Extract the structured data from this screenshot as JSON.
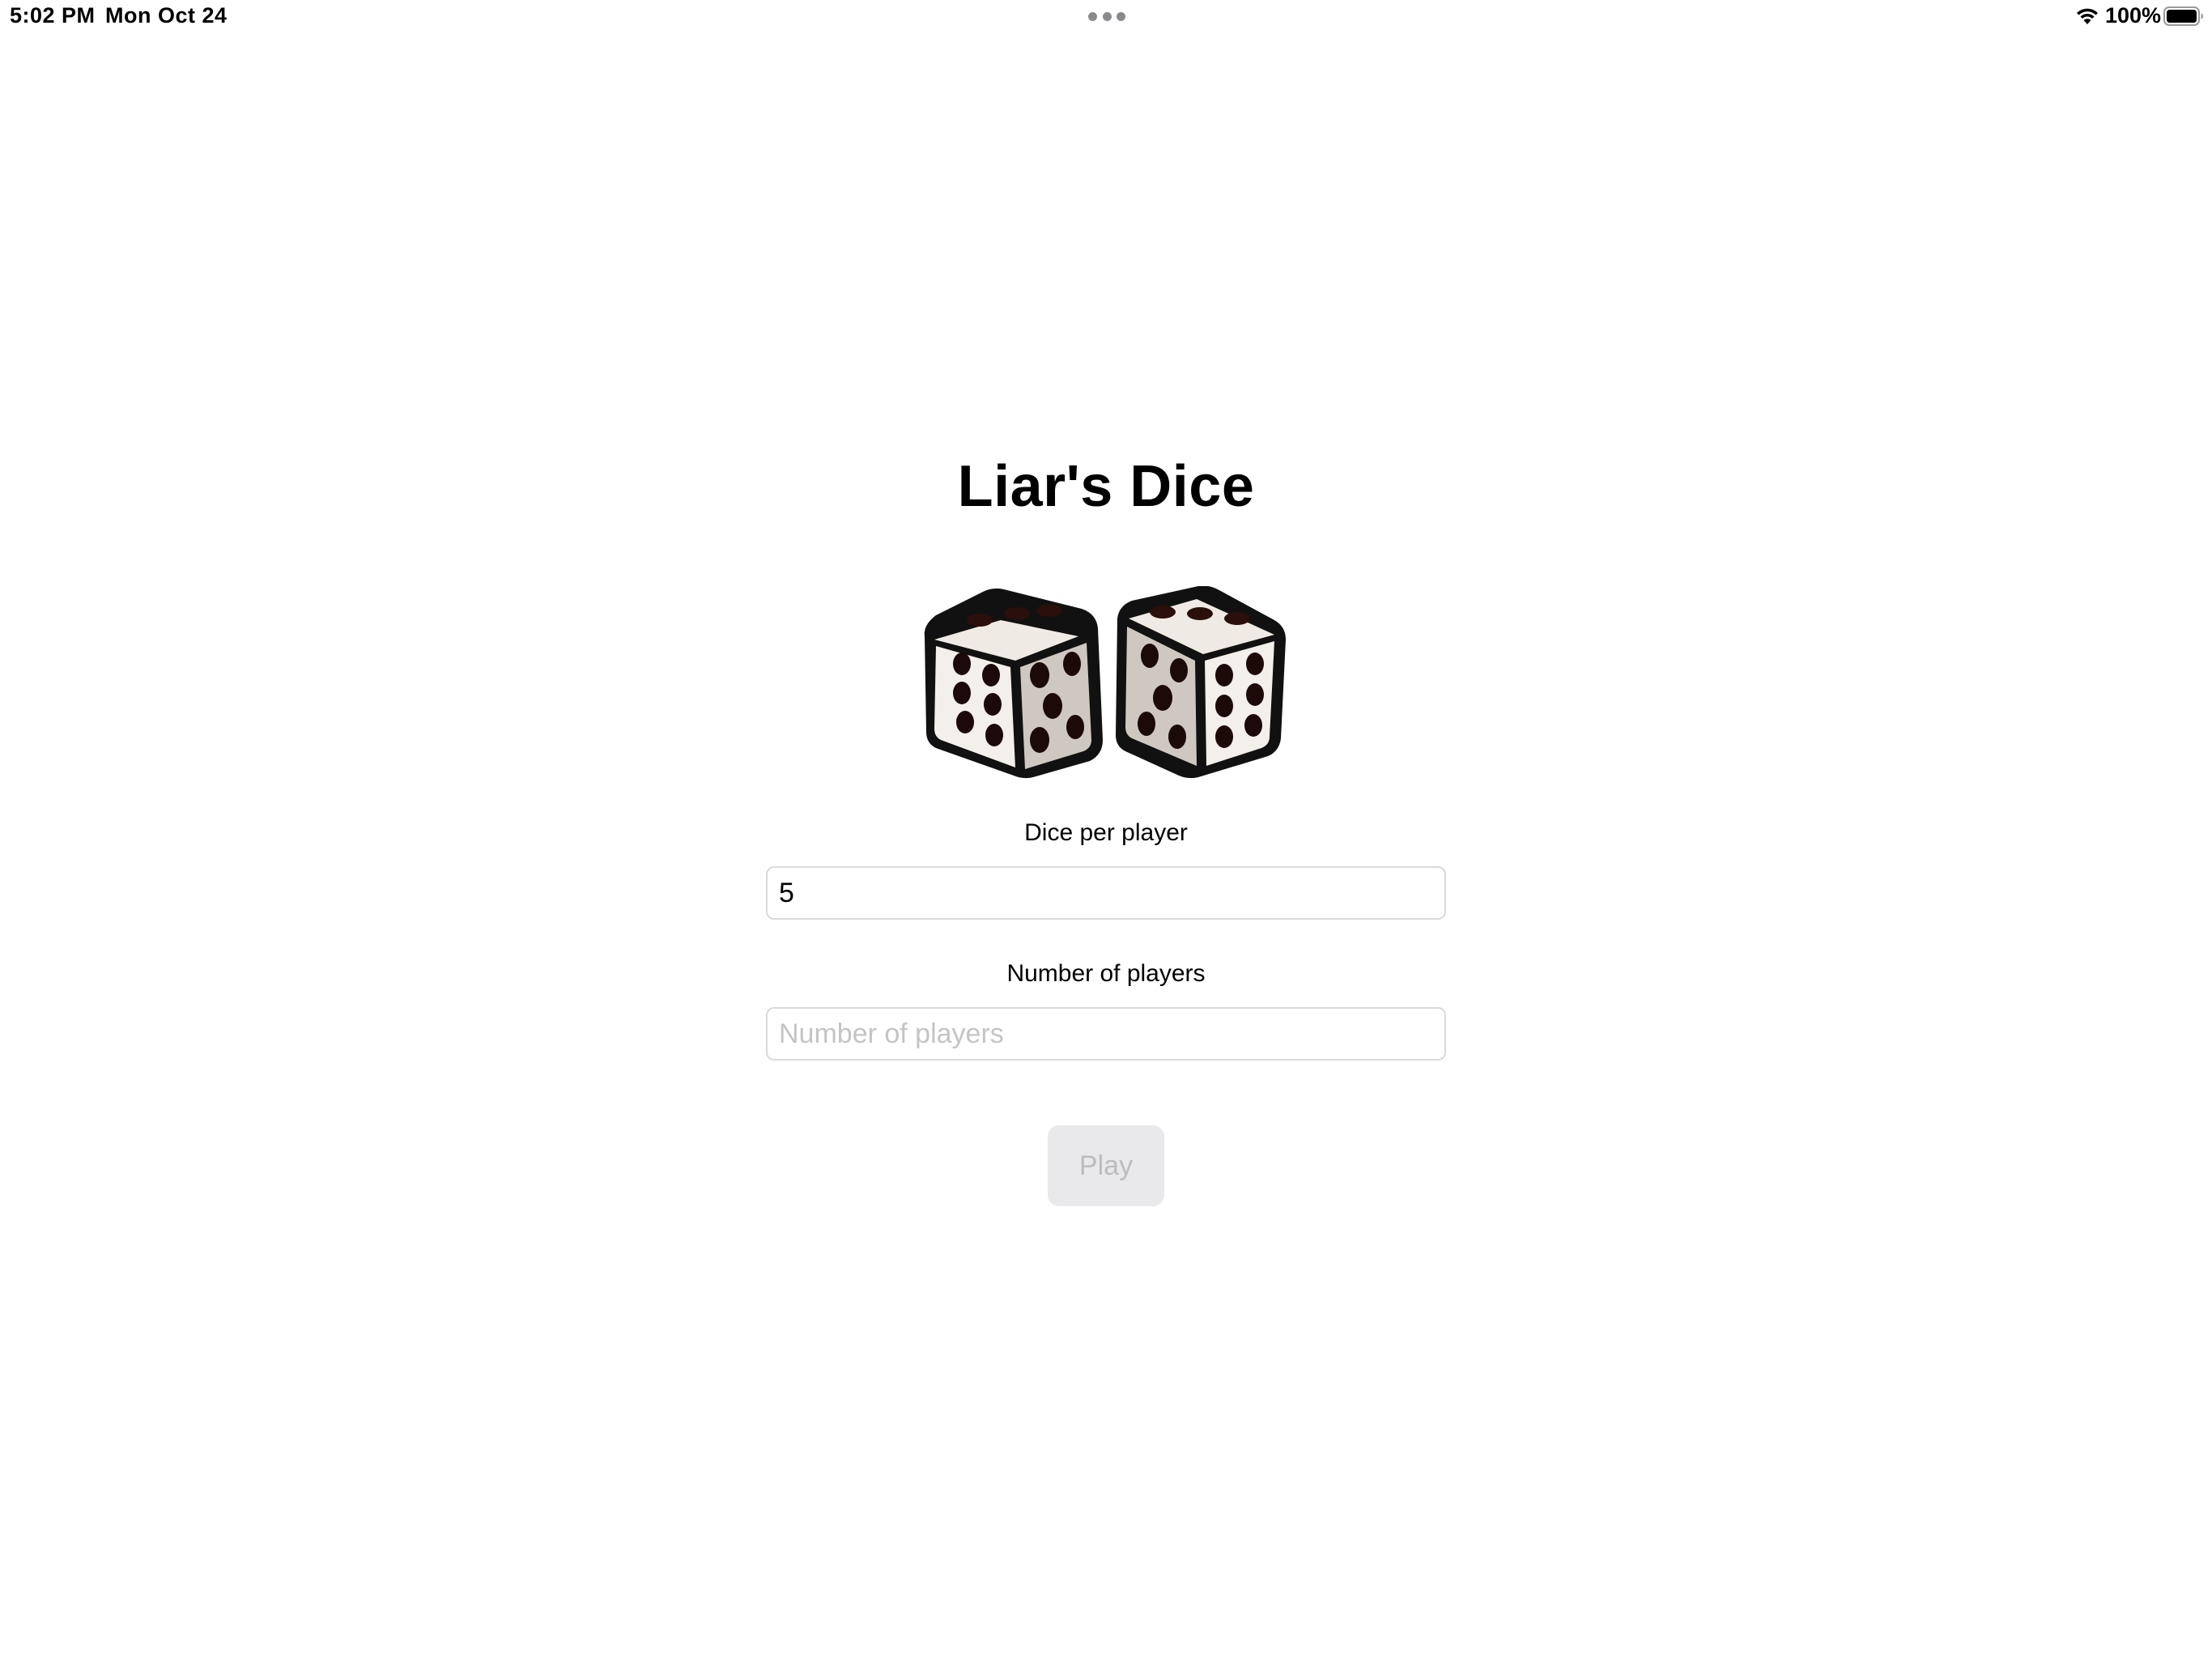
{
  "status_bar": {
    "time": "5:02 PM",
    "date": "Mon Oct 24",
    "battery_percent": "100%",
    "icons": [
      "multitasking-dots-icon",
      "wifi-icon",
      "battery-icon"
    ]
  },
  "app": {
    "title": "Liar's Dice",
    "image": "dice-pair-illustration"
  },
  "form": {
    "dice_per_player": {
      "label": "Dice per player",
      "value": "5",
      "placeholder": ""
    },
    "number_of_players": {
      "label": "Number of players",
      "value": "",
      "placeholder": "Number of players"
    },
    "play_button": {
      "label": "Play",
      "enabled": false
    }
  },
  "colors": {
    "background": "#ffffff",
    "text": "#000000",
    "field_border": "#dadada",
    "placeholder": "#c4c4c6",
    "button_disabled_bg": "#e9e9eb",
    "button_disabled_text": "#bcbcc0"
  }
}
